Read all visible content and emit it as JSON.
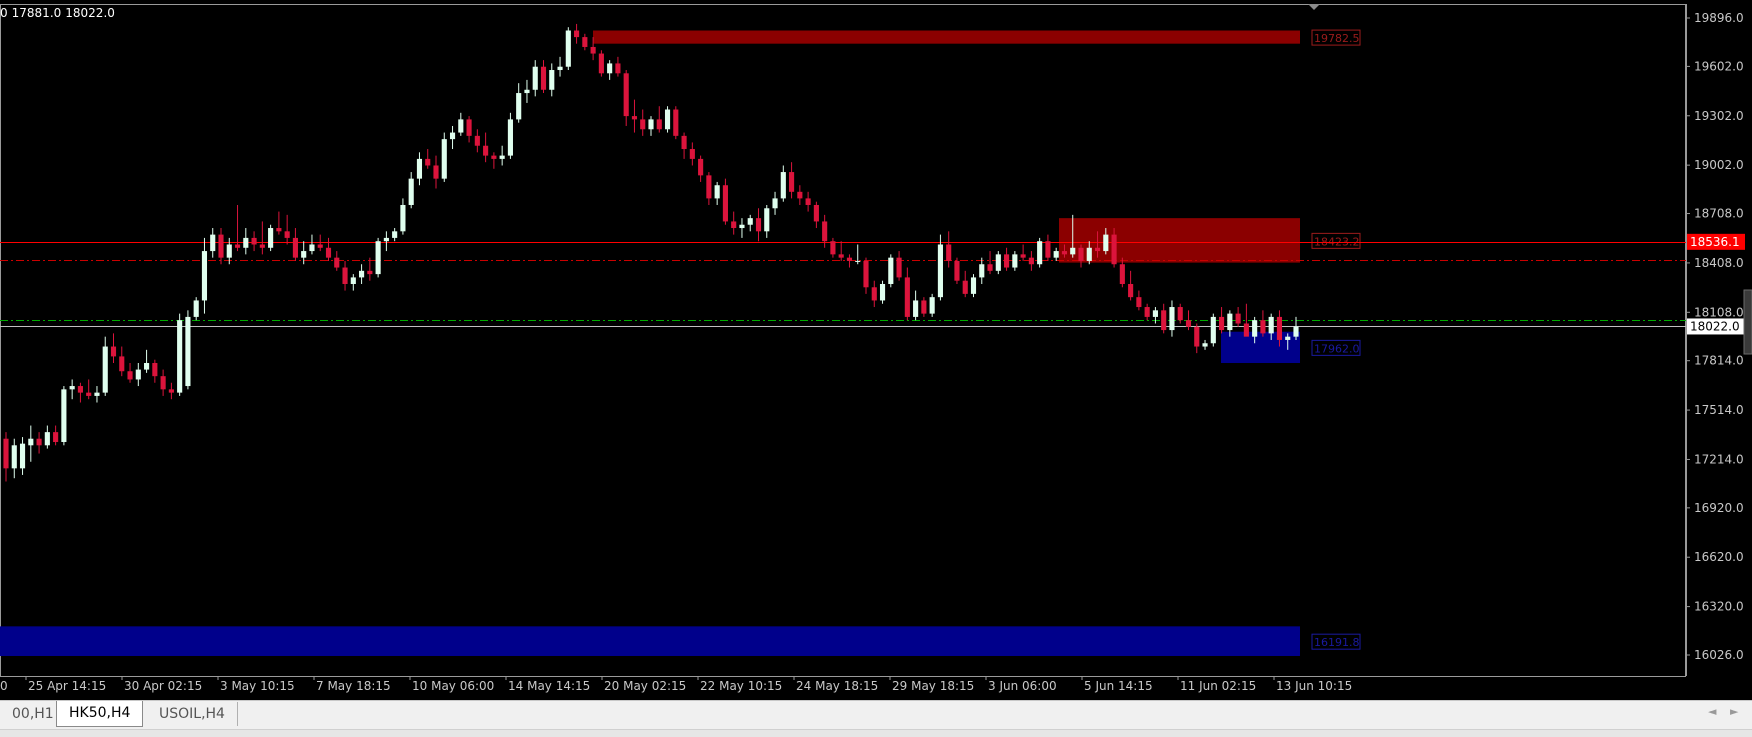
{
  "ohlc_readout": {
    "low": "17881.0",
    "close": "18022.0",
    "prefix": "0"
  },
  "chart_data": {
    "type": "candlestick",
    "symbol_timeframe": "HK50,H4",
    "ylim": [
      15900,
      20050
    ],
    "y_ticks": [
      "19896.0",
      "19602.0",
      "19302.0",
      "19002.0",
      "18708.0",
      "18408.0",
      "18108.0",
      "17814.0",
      "17514.0",
      "17214.0",
      "16920.0",
      "16620.0",
      "16320.0",
      "16026.0"
    ],
    "x_ticks": [
      "25 Apr 14:15",
      "30 Apr 02:15",
      "3 May 10:15",
      "7 May 18:15",
      "10 May 06:00",
      "14 May 14:15",
      "20 May 02:15",
      "22 May 10:15",
      "24 May 18:15",
      "29 May 18:15",
      "3 Jun 06:00",
      "5 Jun 14:15",
      "11 Jun 02:15",
      "13 Jun 10:15"
    ],
    "x_tick_clipped_left": "0",
    "bull_color": "#e0ffef",
    "bear_color": "#dc143c",
    "candles": [
      [
        17340,
        17380,
        17080,
        17160
      ],
      [
        17160,
        17340,
        17100,
        17300
      ],
      [
        17160,
        17350,
        17120,
        17310
      ],
      [
        17300,
        17420,
        17200,
        17340
      ],
      [
        17340,
        17380,
        17250,
        17300
      ],
      [
        17300,
        17420,
        17280,
        17380
      ],
      [
        17380,
        17420,
        17300,
        17320
      ],
      [
        17320,
        17660,
        17300,
        17640
      ],
      [
        17640,
        17700,
        17580,
        17660
      ],
      [
        17660,
        17680,
        17560,
        17620
      ],
      [
        17620,
        17700,
        17580,
        17600
      ],
      [
        17600,
        17660,
        17560,
        17620
      ],
      [
        17620,
        17960,
        17600,
        17900
      ],
      [
        17900,
        17980,
        17800,
        17840
      ],
      [
        17840,
        17900,
        17720,
        17750
      ],
      [
        17750,
        17800,
        17680,
        17700
      ],
      [
        17700,
        17800,
        17660,
        17760
      ],
      [
        17760,
        17880,
        17740,
        17800
      ],
      [
        17800,
        17820,
        17680,
        17720
      ],
      [
        17720,
        17760,
        17600,
        17640
      ],
      [
        17640,
        17680,
        17580,
        17620
      ],
      [
        17620,
        18100,
        17600,
        18060
      ],
      [
        17660,
        18120,
        17640,
        18080
      ],
      [
        18080,
        18200,
        18060,
        18180
      ],
      [
        18180,
        18560,
        18100,
        18480
      ],
      [
        18480,
        18620,
        18440,
        18580
      ],
      [
        18580,
        18620,
        18400,
        18440
      ],
      [
        18440,
        18560,
        18400,
        18520
      ],
      [
        18520,
        18760,
        18480,
        18500
      ],
      [
        18500,
        18620,
        18460,
        18560
      ],
      [
        18560,
        18600,
        18480,
        18520
      ],
      [
        18520,
        18660,
        18460,
        18500
      ],
      [
        18500,
        18640,
        18480,
        18620
      ],
      [
        18620,
        18720,
        18580,
        18600
      ],
      [
        18600,
        18700,
        18520,
        18560
      ],
      [
        18560,
        18620,
        18420,
        18440
      ],
      [
        18440,
        18540,
        18400,
        18480
      ],
      [
        18480,
        18580,
        18460,
        18520
      ],
      [
        18520,
        18580,
        18480,
        18500
      ],
      [
        18500,
        18560,
        18420,
        18440
      ],
      [
        18440,
        18480,
        18360,
        18380
      ],
      [
        18380,
        18420,
        18240,
        18280
      ],
      [
        18280,
        18340,
        18240,
        18320
      ],
      [
        18320,
        18400,
        18280,
        18360
      ],
      [
        18360,
        18440,
        18300,
        18340
      ],
      [
        18340,
        18560,
        18320,
        18540
      ],
      [
        18540,
        18600,
        18480,
        18560
      ],
      [
        18560,
        18620,
        18540,
        18600
      ],
      [
        18600,
        18800,
        18580,
        18760
      ],
      [
        18760,
        18960,
        18740,
        18920
      ],
      [
        18920,
        19080,
        18880,
        19040
      ],
      [
        19040,
        19100,
        18980,
        19000
      ],
      [
        19000,
        19060,
        18860,
        18920
      ],
      [
        18920,
        19200,
        18900,
        19160
      ],
      [
        19160,
        19240,
        19100,
        19200
      ],
      [
        19200,
        19320,
        19180,
        19280
      ],
      [
        19280,
        19300,
        19140,
        19180
      ],
      [
        19180,
        19220,
        19080,
        19120
      ],
      [
        19120,
        19200,
        19020,
        19060
      ],
      [
        19060,
        19080,
        18980,
        19040
      ],
      [
        19040,
        19120,
        19000,
        19060
      ],
      [
        19060,
        19320,
        19040,
        19280
      ],
      [
        19280,
        19500,
        19260,
        19440
      ],
      [
        19440,
        19520,
        19380,
        19460
      ],
      [
        19460,
        19640,
        19420,
        19600
      ],
      [
        19600,
        19640,
        19440,
        19460
      ],
      [
        19460,
        19620,
        19420,
        19580
      ],
      [
        19580,
        19660,
        19540,
        19600
      ],
      [
        19600,
        19840,
        19580,
        19820
      ],
      [
        19820,
        19860,
        19740,
        19780
      ],
      [
        19780,
        19800,
        19700,
        19720
      ],
      [
        19720,
        19780,
        19640,
        19680
      ],
      [
        19680,
        19700,
        19540,
        19560
      ],
      [
        19560,
        19640,
        19520,
        19620
      ],
      [
        19620,
        19660,
        19540,
        19560
      ],
      [
        19560,
        19580,
        19240,
        19300
      ],
      [
        19300,
        19400,
        19200,
        19280
      ],
      [
        19280,
        19340,
        19180,
        19220
      ],
      [
        19220,
        19300,
        19180,
        19280
      ],
      [
        19280,
        19360,
        19200,
        19220
      ],
      [
        19220,
        19360,
        19200,
        19340
      ],
      [
        19340,
        19360,
        19160,
        19180
      ],
      [
        19180,
        19200,
        19040,
        19100
      ],
      [
        19100,
        19140,
        19000,
        19040
      ],
      [
        19040,
        19060,
        18900,
        18940
      ],
      [
        18940,
        18960,
        18760,
        18800
      ],
      [
        18800,
        18900,
        18760,
        18880
      ],
      [
        18880,
        18920,
        18640,
        18660
      ],
      [
        18660,
        18720,
        18580,
        18620
      ],
      [
        18620,
        18680,
        18560,
        18640
      ],
      [
        18640,
        18700,
        18600,
        18680
      ],
      [
        18680,
        18740,
        18540,
        18600
      ],
      [
        18600,
        18760,
        18560,
        18740
      ],
      [
        18740,
        18840,
        18700,
        18800
      ],
      [
        18800,
        19000,
        18780,
        18960
      ],
      [
        18960,
        19020,
        18800,
        18840
      ],
      [
        18840,
        18880,
        18760,
        18800
      ],
      [
        18800,
        18840,
        18720,
        18760
      ],
      [
        18760,
        18780,
        18620,
        18660
      ],
      [
        18660,
        18700,
        18500,
        18540
      ],
      [
        18540,
        18560,
        18440,
        18460
      ],
      [
        18460,
        18540,
        18420,
        18440
      ],
      [
        18440,
        18460,
        18380,
        18420
      ],
      [
        18420,
        18520,
        18400,
        18420
      ],
      [
        18420,
        18440,
        18220,
        18260
      ],
      [
        18260,
        18300,
        18140,
        18180
      ],
      [
        18180,
        18300,
        18160,
        18280
      ],
      [
        18280,
        18460,
        18260,
        18440
      ],
      [
        18440,
        18480,
        18300,
        18320
      ],
      [
        18320,
        18380,
        18060,
        18080
      ],
      [
        18080,
        18240,
        18060,
        18180
      ],
      [
        18180,
        18200,
        18080,
        18100
      ],
      [
        18100,
        18220,
        18080,
        18200
      ],
      [
        18200,
        18580,
        18180,
        18520
      ],
      [
        18520,
        18600,
        18380,
        18420
      ],
      [
        18420,
        18440,
        18280,
        18300
      ],
      [
        18300,
        18360,
        18200,
        18220
      ],
      [
        18220,
        18340,
        18200,
        18320
      ],
      [
        18320,
        18440,
        18280,
        18400
      ],
      [
        18400,
        18480,
        18340,
        18360
      ],
      [
        18360,
        18480,
        18340,
        18460
      ],
      [
        18460,
        18500,
        18360,
        18380
      ],
      [
        18380,
        18480,
        18360,
        18460
      ],
      [
        18460,
        18520,
        18420,
        18440
      ],
      [
        18440,
        18480,
        18360,
        18400
      ],
      [
        18400,
        18560,
        18380,
        18540
      ],
      [
        18540,
        18580,
        18420,
        18440
      ],
      [
        18440,
        18500,
        18420,
        18480
      ],
      [
        18480,
        18520,
        18440,
        18460
      ],
      [
        18460,
        18700,
        18440,
        18500
      ],
      [
        18500,
        18520,
        18380,
        18420
      ],
      [
        18420,
        18540,
        18400,
        18500
      ],
      [
        18500,
        18600,
        18440,
        18480
      ],
      [
        18480,
        18620,
        18460,
        18580
      ],
      [
        18580,
        18620,
        18380,
        18400
      ],
      [
        18400,
        18440,
        18260,
        18280
      ],
      [
        18280,
        18360,
        18180,
        18200
      ],
      [
        18200,
        18240,
        18120,
        18140
      ],
      [
        18140,
        18160,
        18060,
        18080
      ],
      [
        18080,
        18140,
        18040,
        18120
      ],
      [
        18120,
        18160,
        17980,
        18000
      ],
      [
        18000,
        18180,
        17960,
        18140
      ],
      [
        18140,
        18160,
        18040,
        18060
      ],
      [
        18060,
        18120,
        18000,
        18020
      ],
      [
        18020,
        18040,
        17860,
        17900
      ],
      [
        17900,
        17940,
        17880,
        17920
      ],
      [
        17920,
        18100,
        17900,
        18080
      ],
      [
        18080,
        18140,
        17980,
        18000
      ],
      [
        18000,
        18120,
        17960,
        18100
      ],
      [
        18100,
        18140,
        18020,
        18040
      ],
      [
        18040,
        18160,
        18000,
        17960
      ],
      [
        17960,
        18080,
        17920,
        18060
      ],
      [
        18060,
        18120,
        17960,
        17980
      ],
      [
        17980,
        18100,
        17940,
        18080
      ],
      [
        18080,
        18120,
        17900,
        17940
      ],
      [
        17940,
        17980,
        17880,
        17960
      ],
      [
        17960,
        18080,
        17940,
        18022
      ]
    ],
    "horizontal_levels": [
      {
        "price": 18536.1,
        "label": "18536.1",
        "color": "#ff0000",
        "style": "solid"
      },
      {
        "price": 18423.2,
        "label": "18423.2",
        "color": "#cc0000",
        "style": "dash-dot"
      },
      {
        "price": 18060.0,
        "label": "",
        "color": "#00aa00",
        "style": "dash-dot"
      },
      {
        "price": 18022.0,
        "label": "18022.0",
        "color": "#c0c0c0",
        "style": "solid"
      }
    ],
    "zones": [
      {
        "price_top": 19820,
        "price_bottom": 19740,
        "label": "19782.5",
        "color": "#8b0000",
        "label_color": "#9b1c1c",
        "start": 0.352,
        "end": 0.772,
        "full_width": false
      },
      {
        "price_top": 18680,
        "price_bottom": 18410,
        "label": "18423.2",
        "color": "#8b0000",
        "label_color": "#9b1c1c",
        "start": 0.629,
        "end": 0.772,
        "full_width": false
      },
      {
        "price_top": 17990,
        "price_bottom": 17800,
        "label": "17962.0",
        "color": "#00008b",
        "label_color": "#1a1aa0",
        "start": 0.725,
        "end": 0.772,
        "full_width": false
      },
      {
        "price_top": 16200,
        "price_bottom": 16020,
        "label": "16191.8",
        "color": "#00008b",
        "label_color": "#1a1aa0",
        "start": 0.0,
        "end": 0.772,
        "full_width": true
      }
    ],
    "current_price_label": "18022.0",
    "price_axis_highlight": {
      "label": "18536.1",
      "color": "#ff0000"
    }
  },
  "tabs": [
    {
      "label": "00,H1",
      "active": false
    },
    {
      "label": "HK50,H4",
      "active": true
    },
    {
      "label": "USOIL,H4",
      "active": false
    }
  ],
  "tab_nav": {
    "left": "◄",
    "right": "►"
  }
}
